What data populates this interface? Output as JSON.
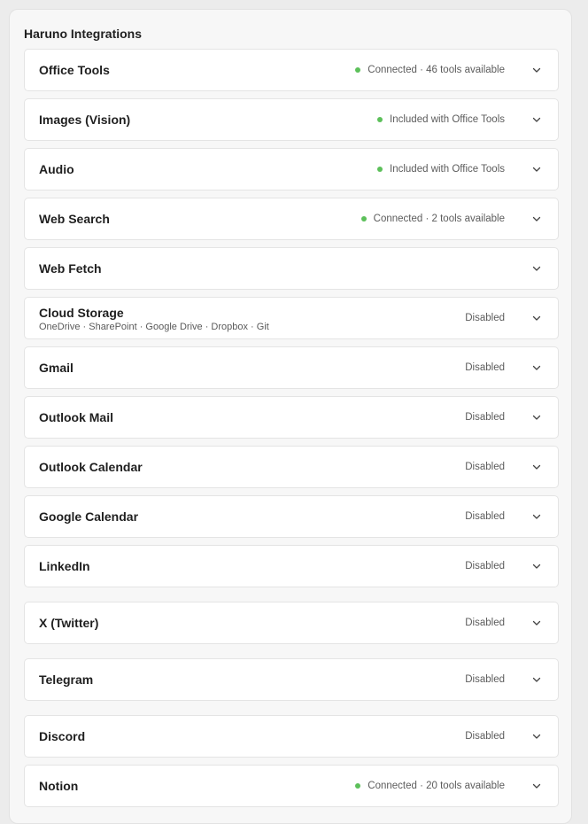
{
  "panel": {
    "title": "Haruno Integrations"
  },
  "colors": {
    "connected": "#5cc05a"
  },
  "integrations": [
    {
      "name": "Office Tools",
      "sub": "",
      "status": "Connected · 46 tools available",
      "active": true
    },
    {
      "name": "Images (Vision)",
      "sub": "",
      "status": "Included with Office Tools",
      "active": true
    },
    {
      "name": "Audio",
      "sub": "",
      "status": "Included with Office Tools",
      "active": true
    },
    {
      "name": "Web Search",
      "sub": "",
      "status": "Connected · 2 tools available",
      "active": true
    },
    {
      "name": "Web Fetch",
      "sub": "",
      "status": "",
      "active": false
    },
    {
      "name": "Cloud Storage",
      "sub": "OneDrive · SharePoint · Google Drive · Dropbox · Git",
      "status": "Disabled",
      "active": false
    },
    {
      "name": "Gmail",
      "sub": "",
      "status": "Disabled",
      "active": false
    },
    {
      "name": "Outlook Mail",
      "sub": "",
      "status": "Disabled",
      "active": false
    },
    {
      "name": "Outlook Calendar",
      "sub": "",
      "status": "Disabled",
      "active": false
    },
    {
      "name": "Google Calendar",
      "sub": "",
      "status": "Disabled",
      "active": false
    },
    {
      "name": "LinkedIn",
      "sub": "",
      "status": "Disabled",
      "active": false
    },
    {
      "name": "X (Twitter)",
      "sub": "",
      "status": "Disabled",
      "active": false
    },
    {
      "name": "Telegram",
      "sub": "",
      "status": "Disabled",
      "active": false
    },
    {
      "name": "Discord",
      "sub": "",
      "status": "Disabled",
      "active": false
    },
    {
      "name": "Notion",
      "sub": "",
      "status": "Connected · 20 tools available",
      "active": true
    }
  ]
}
